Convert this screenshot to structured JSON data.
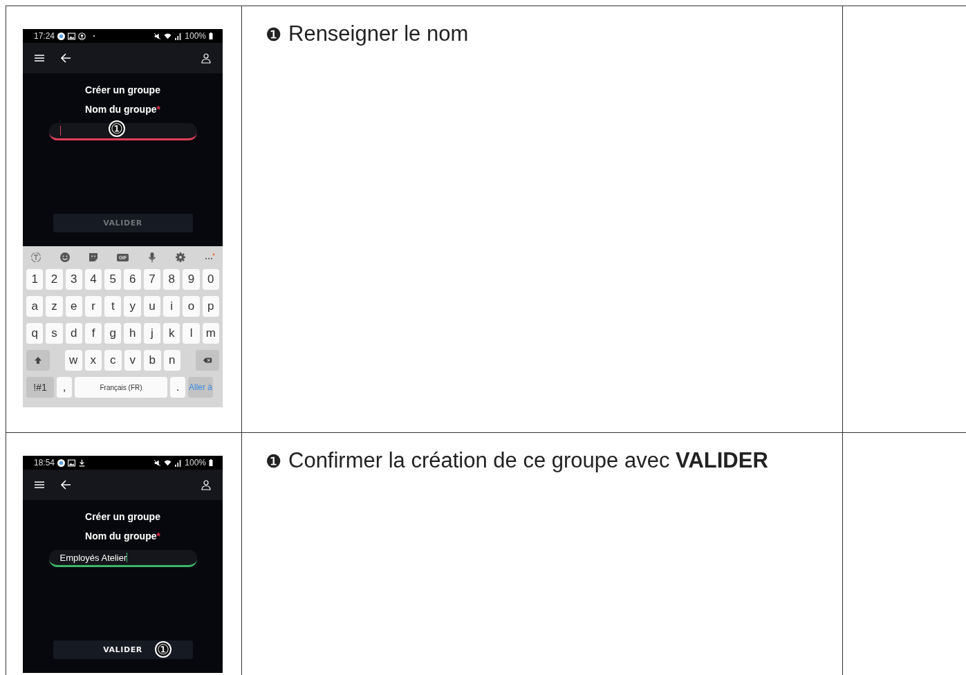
{
  "rows": [
    {
      "phone": {
        "time": "17:24",
        "notifications": [
          {
            "kind": "app"
          },
          {
            "kind": "image"
          },
          {
            "kind": "account"
          },
          {
            "kind": "dot"
          }
        ],
        "battery": "100%",
        "title": "Créer un groupe",
        "field": {
          "label": "Nom du groupe",
          "required_mark": "*",
          "valid": false,
          "callout": "①"
        },
        "button": {
          "label": "VALIDER",
          "enabled": false
        },
        "keyboard": {
          "gif": "GIF",
          "key_rows": [
            {
              "keys": [
                "1",
                "2",
                "3",
                "4",
                "5",
                "6",
                "7",
                "8",
                "9",
                "0"
              ]
            },
            {
              "keys": [
                "a",
                "z",
                "e",
                "r",
                "t",
                "y",
                "u",
                "i",
                "o",
                "p"
              ]
            },
            {
              "keys": [
                "q",
                "s",
                "d",
                "f",
                "g",
                "h",
                "j",
                "k",
                "l",
                "m"
              ]
            }
          ],
          "shift_row": {
            "keys": [
              "w",
              "x",
              "c",
              "v",
              "b",
              "n"
            ]
          },
          "symbols": "!#1",
          "comma": ",",
          "space": "Français (FR)",
          "period": ".",
          "action": "Aller à"
        }
      },
      "marker": "❶",
      "instruction": "Renseigner le nom"
    },
    {
      "phone": {
        "time": "18:54",
        "notifications": [
          {
            "kind": "app"
          },
          {
            "kind": "image"
          },
          {
            "kind": "download"
          }
        ],
        "battery": "100%",
        "title": "Créer un groupe",
        "field": {
          "label": "Nom du groupe",
          "required_mark": "*",
          "value": "Employés Atelier",
          "valid": true
        },
        "button": {
          "label": "VALIDER",
          "enabled": true,
          "callout": "①"
        }
      },
      "marker": "❶",
      "instruction": "Confirmer la création de ce groupe avec **VALIDER**"
    }
  ]
}
